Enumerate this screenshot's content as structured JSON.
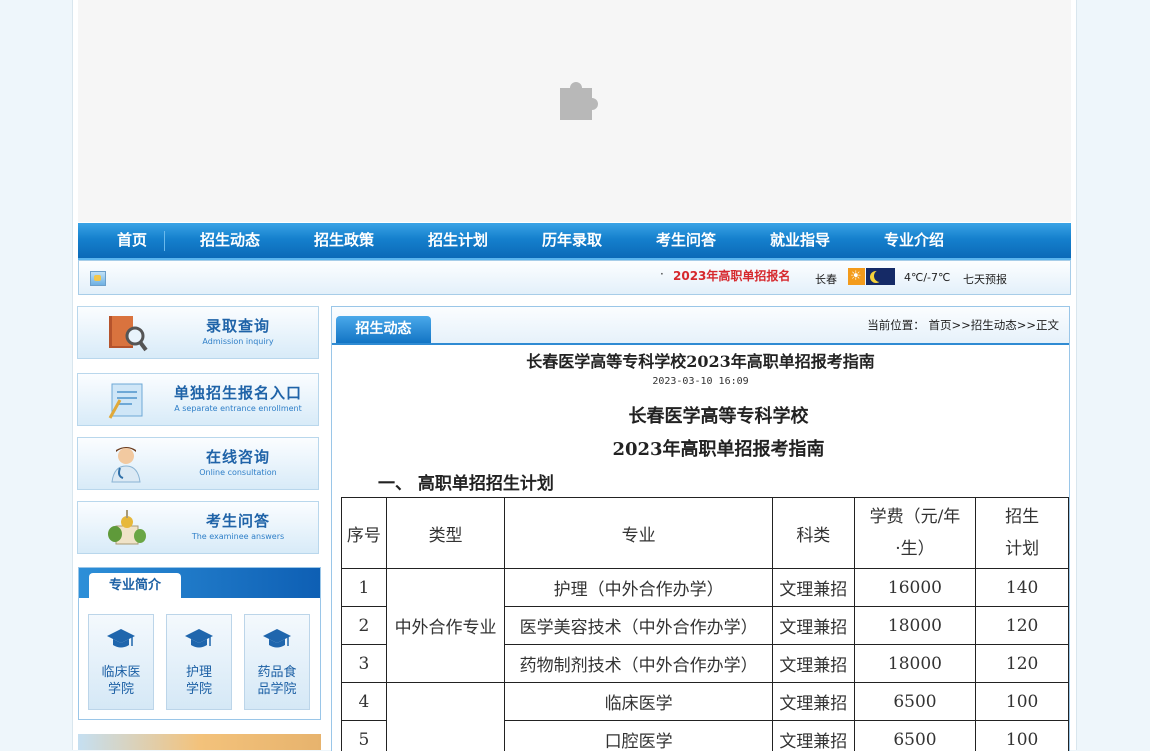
{
  "nav": {
    "items": [
      "首页",
      "招生动态",
      "招生政策",
      "招生计划",
      "历年录取",
      "考生问答",
      "就业指导",
      "专业介绍"
    ]
  },
  "infobar": {
    "news_bullet": "·",
    "news_text": "2023年高职单招报名",
    "city": "长春",
    "temperature": "4℃/-7℃",
    "forecast_link": "七天预报"
  },
  "quick_links": [
    {
      "cn": "录取查询",
      "en": "Admission inquiry",
      "icon": "book-magnifier-icon"
    },
    {
      "cn": "单独招生报名入口",
      "en": "A separate entrance enrollment",
      "icon": "registration-form-icon"
    },
    {
      "cn": "在线咨询",
      "en": "Online consultation",
      "icon": "doctor-consult-icon"
    },
    {
      "cn": "考生问答",
      "en": "The examinee answers",
      "icon": "castle-qa-icon"
    }
  ],
  "intro": {
    "title": "专业简介",
    "colleges": [
      {
        "line1": "临床医",
        "line2": "学院"
      },
      {
        "line1": "护理",
        "line2": "学院"
      },
      {
        "line1": "药品食",
        "line2": "品学院"
      }
    ]
  },
  "content": {
    "tab": "招生动态",
    "breadcrumb": "当前位置： 首页>>招生动态>>正文",
    "title": "长春医学高等专科学校2023年高职单招报考指南",
    "date": "2023-03-10 16:09",
    "school_heading": "长春医学高等专科学校",
    "guide_heading": "2023年高职单招报考指南",
    "section_heading": "一、 高职单招招生计划"
  },
  "table": {
    "headers": [
      "序号",
      "类型",
      "专业",
      "科类",
      "学费（元/年·生）",
      "招生计划"
    ],
    "header_fee_l1": "学费（元/年",
    "header_fee_l2": "·生）",
    "header_plan_l1": "招生",
    "header_plan_l2": "计划",
    "group1": "中外合作专业",
    "rows": [
      {
        "no": "1",
        "major": "护理（中外合作办学）",
        "subject": "文理兼招",
        "fee": "16000",
        "plan": "140"
      },
      {
        "no": "2",
        "major": "医学美容技术（中外合作办学）",
        "subject": "文理兼招",
        "fee": "18000",
        "plan": "120"
      },
      {
        "no": "3",
        "major": "药物制剂技术（中外合作办学）",
        "subject": "文理兼招",
        "fee": "18000",
        "plan": "120"
      },
      {
        "no": "4",
        "major": "临床医学",
        "subject": "文理兼招",
        "fee": "6500",
        "plan": "100"
      },
      {
        "no": "5",
        "major": "口腔医学",
        "subject": "文理兼招",
        "fee": "6500",
        "plan": "100"
      }
    ]
  }
}
